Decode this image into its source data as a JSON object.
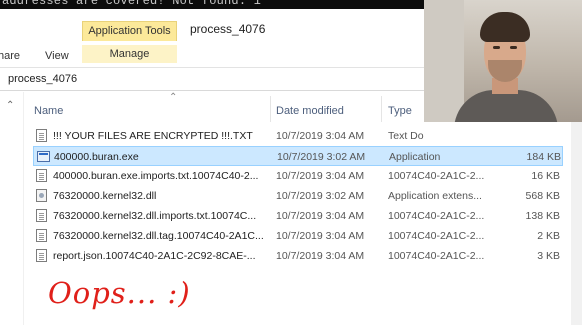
{
  "terminal": {
    "text": "addresses are covered! Not found: 1"
  },
  "ribbon": {
    "context_tab": "Application Tools",
    "window_title": "process_4076",
    "tabs": [
      "hare",
      "View",
      "Manage"
    ]
  },
  "address": {
    "path": "process_4076"
  },
  "columns": {
    "name": "Name",
    "date": "Date modified",
    "type": "Type"
  },
  "files": [
    {
      "name": "!!! YOUR FILES ARE ENCRYPTED !!!.TXT",
      "date": "10/7/2019 3:04 AM",
      "type": "Text Do",
      "size": "",
      "icon": "text-file-icon",
      "selected": false
    },
    {
      "name": "400000.buran.exe",
      "date": "10/7/2019 3:02 AM",
      "type": "Application",
      "size": "184 KB",
      "icon": "exe-file-icon",
      "selected": true
    },
    {
      "name": "400000.buran.exe.imports.txt.10074C40-2...",
      "date": "10/7/2019 3:04 AM",
      "type": "10074C40-2A1C-2...",
      "size": "16 KB",
      "icon": "text-file-icon",
      "selected": false
    },
    {
      "name": "76320000.kernel32.dll",
      "date": "10/7/2019 3:02 AM",
      "type": "Application extens...",
      "size": "568 KB",
      "icon": "dll-file-icon",
      "selected": false
    },
    {
      "name": "76320000.kernel32.dll.imports.txt.10074C...",
      "date": "10/7/2019 3:04 AM",
      "type": "10074C40-2A1C-2...",
      "size": "138 KB",
      "icon": "text-file-icon",
      "selected": false
    },
    {
      "name": "76320000.kernel32.dll.tag.10074C40-2A1C...",
      "date": "10/7/2019 3:04 AM",
      "type": "10074C40-2A1C-2...",
      "size": "2 KB",
      "icon": "text-file-icon",
      "selected": false
    },
    {
      "name": "report.json.10074C40-2A1C-2C92-8CAE-...",
      "date": "10/7/2019 3:04 AM",
      "type": "10074C40-2A1C-2...",
      "size": "3 KB",
      "icon": "text-file-icon",
      "selected": false
    }
  ],
  "caption": {
    "text": "Oops... :)",
    "color": "#e0201a"
  }
}
